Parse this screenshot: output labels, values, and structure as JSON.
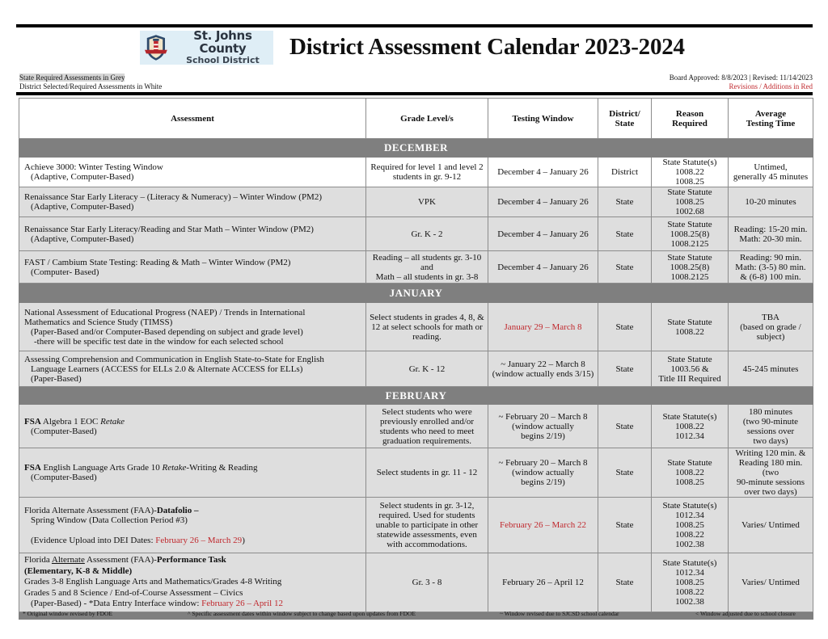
{
  "header": {
    "logo": {
      "line1": "St. Johns County",
      "line2": "School District",
      "icon": "lighthouse-shield-logo-icon"
    },
    "title": "District Assessment Calendar 2023-2024",
    "legend_grey": "State Required Assessments in Grey",
    "legend_white": "District Selected/Required Assessments in White",
    "approved": "Board Approved:  8/8/2023 |  Revised: 11/14/2023",
    "revisions_note": "Revisions / Additions in Red"
  },
  "colors": {
    "accent_red": "#c0282d",
    "month_bar": "#7f7f7f",
    "state_row": "#dedede",
    "district_row": "#ffffff"
  },
  "table": {
    "columns": [
      "Assessment",
      "Grade Level/s",
      "Testing Window",
      "District/ State",
      "Reason Required",
      "Average Testing Time"
    ],
    "months": [
      "DECEMBER",
      "JANUARY",
      "FEBRUARY"
    ],
    "rows": [
      {
        "a1": "Achieve 3000:  Winter Testing Window",
        "a2": "(Adaptive, Computer-Based)",
        "grade": "Required for level 1 and level 2 students in gr. 9-12",
        "window": "December 4 – January 26",
        "ds": "District",
        "reason": [
          "State Statute(s)",
          "1008.22",
          "1008.25"
        ],
        "time": [
          "Untimed,",
          "generally 45 minutes"
        ]
      },
      {
        "a1": "Renaissance Star Early Literacy – (Literacy & Numeracy) – Winter Window (PM2)",
        "a2": "(Adaptive, Computer-Based)",
        "grade": "VPK",
        "window": "December 4 – January 26",
        "ds": "State",
        "reason": [
          "State Statute",
          "1008.25",
          "1002.68"
        ],
        "time": [
          "10-20 minutes"
        ]
      },
      {
        "a1": "Renaissance Star Early Literacy/Reading and Star Math – Winter Window (PM2)",
        "a2": "(Adaptive, Computer-Based)",
        "grade": "Gr. K - 2",
        "window": "December 4 – January 26",
        "ds": "State",
        "reason": [
          "State Statute",
          "1008.25(8)",
          "1008.2125"
        ],
        "time": [
          "Reading: 15-20 min.",
          "Math: 20-30 min."
        ]
      },
      {
        "a1": "FAST / Cambium State Testing:  Reading & Math – Winter Window (PM2)",
        "a2": "(Computer- Based)",
        "grade": [
          "Reading – all students gr. 3-10",
          "and",
          "Math – all students in gr. 3-8"
        ],
        "window": "December 4 – January 26",
        "ds": "State",
        "reason": [
          "State Statute",
          "1008.25(8)",
          "1008.2125"
        ],
        "time": [
          "Reading: 90 min.",
          "Math: (3-5) 80 min.",
          "& (6-8) 100 min."
        ]
      },
      {
        "a1": "National Assessment of Educational Progress (NAEP) / Trends in International",
        "a2": "Mathematics and Science Study (TIMSS)",
        "a3": "(Paper-Based and/or Computer-Based depending on subject and grade level)",
        "a4": "-there will be specific test date in the window for each selected school",
        "grade": "Select students in grades 4, 8, & 12 at select schools for math or reading.",
        "window": "January 29 – March 8",
        "ds": "State",
        "reason": [
          "State Statute",
          "1008.22"
        ],
        "time": [
          "TBA",
          "(based on grade /",
          "subject)"
        ]
      },
      {
        "a1": "Assessing Comprehension and Communication in English State-to-State for English",
        "a2": "Language Learners (ACCESS for ELLs 2.0 & Alternate ACCESS for ELLs)",
        "a3": "(Paper-Based)",
        "grade": "Gr. K - 12",
        "window": [
          "~ January 22 – March 8",
          "(window actually ends 3/15)"
        ],
        "ds": "State",
        "reason": [
          "State Statute",
          "1003.56 &",
          "Title III Required"
        ],
        "time": [
          "45-245 minutes"
        ]
      },
      {
        "a_bold": "FSA",
        "a_mid": " Algebra 1 EOC ",
        "a_ital": "Retake",
        "a2": "(Computer-Based)",
        "grade": "Select students who were previously enrolled and/or students who need to meet graduation requirements.",
        "window": [
          "~ February 20 – March 8",
          "(window actually",
          "begins 2/19)"
        ],
        "ds": "State",
        "reason": [
          "State Statute(s)",
          "1008.22",
          "1012.34"
        ],
        "time": [
          "180 minutes",
          "(two 90-minute",
          "sessions over",
          "two days)"
        ]
      },
      {
        "a_bold": "FSA",
        "a_mid": " English Language Arts Grade 10 ",
        "a_ital": "Retake",
        "a_end": "-Writing & Reading",
        "a2": "(Computer-Based)",
        "grade": "Select students in gr. 11 - 12",
        "window": [
          "~ February 20 – March 8",
          "(window actually",
          "begins 2/19)"
        ],
        "ds": "State",
        "reason": [
          "State Statute",
          "1008.22",
          "1008.25"
        ],
        "time": [
          "Writing 120 min. &",
          "Reading 180 min. (two",
          "90-minute sessions",
          "over two days)"
        ]
      },
      {
        "a_pre": "Florida Alternate Assessment (FAA)-",
        "a_bold": "Datafolio –",
        "a2": "Spring Window (Data Collection Period #3)",
        "a3_pre": "(Evidence Upload into DEI Dates:  ",
        "a3_red": "February 26 – March 29",
        "a3_end": ")",
        "grade": "Select students in gr. 3-12, required.  Used for students unable to participate in other statewide assessments, even with accommodations.",
        "window": "February 26 – March 22",
        "ds": "State",
        "reason": [
          "State Statute(s)",
          "1012.34",
          "1008.25",
          "1008.22",
          "1002.38"
        ],
        "time": [
          "Varies/ Untimed"
        ]
      },
      {
        "a_pre": "Florida ",
        "a_under": "Alternate",
        "a_mid": " Assessment (FAA)-",
        "a_bold": "Performance Task",
        "a2_bold": "(Elementary, K-8 & Middle)",
        "a3": "Grades 3-8 English Language Arts and Mathematics/Grades 4-8 Writing",
        "a4": "Grades 5 and 8 Science / End-of-Course Assessment – Civics",
        "a5_pre": "(Paper-Based) - *Data Entry Interface window:  ",
        "a5_red": "February 26 – April 12",
        "grade": "Gr. 3 - 8",
        "window": "February 26 – April 12",
        "ds": "State",
        "reason": [
          "State Statute(s)",
          "1012.34",
          "1008.25",
          "1008.22",
          "1002.38"
        ],
        "time": [
          "Varies/ Untimed"
        ]
      }
    ]
  },
  "footnotes": [
    "* Original window revised by FDOE",
    "^ Specific assessment dates within window subject to change based upon updates from FDOE",
    "~ Window revised due to SJCSD school calendar",
    "< Window adjusted due to school closure"
  ]
}
